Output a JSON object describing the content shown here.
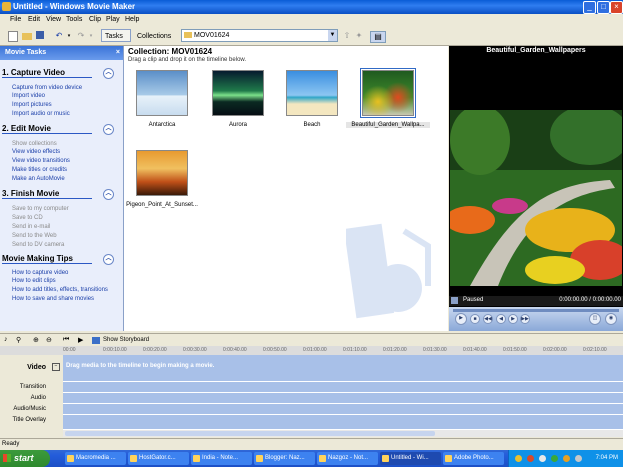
{
  "window": {
    "title": "Untitled - Windows Movie Maker"
  },
  "menu": [
    "File",
    "Edit",
    "View",
    "Tools",
    "Clip",
    "Play",
    "Help"
  ],
  "toolbar": {
    "tasks_label": "Tasks",
    "collections_label": "Collections",
    "combo_value": "MOV01624"
  },
  "taskpane": {
    "header": "Movie Tasks",
    "sections": [
      {
        "title": "1. Capture Video",
        "links": [
          {
            "label": "Capture from video device",
            "enabled": true
          },
          {
            "label": "Import video",
            "enabled": true
          },
          {
            "label": "Import pictures",
            "enabled": true
          },
          {
            "label": "Import audio or music",
            "enabled": true
          }
        ]
      },
      {
        "title": "2. Edit Movie",
        "links": [
          {
            "label": "Show collections",
            "enabled": false
          },
          {
            "label": "View video effects",
            "enabled": true
          },
          {
            "label": "View video transitions",
            "enabled": true
          },
          {
            "label": "Make titles or credits",
            "enabled": true
          },
          {
            "label": "Make an AutoMovie",
            "enabled": true
          }
        ]
      },
      {
        "title": "3. Finish Movie",
        "links": [
          {
            "label": "Save to my computer",
            "enabled": false
          },
          {
            "label": "Save to CD",
            "enabled": false
          },
          {
            "label": "Send in e-mail",
            "enabled": false
          },
          {
            "label": "Send to the Web",
            "enabled": false
          },
          {
            "label": "Send to DV camera",
            "enabled": false
          }
        ]
      },
      {
        "title": "Movie Making Tips",
        "links": [
          {
            "label": "How to capture video",
            "enabled": true
          },
          {
            "label": "How to edit clips",
            "enabled": true
          },
          {
            "label": "How to add titles, effects, transitions",
            "enabled": true
          },
          {
            "label": "How to save and share movies",
            "enabled": true
          }
        ]
      }
    ]
  },
  "collection": {
    "title": "Collection: MOV01624",
    "subtitle": "Drag a clip and drop it on the timeline below.",
    "clips": [
      {
        "label": "Antarctica"
      },
      {
        "label": "Aurora"
      },
      {
        "label": "Beach"
      },
      {
        "label": "Beautiful_Garden_Wallpa..."
      },
      {
        "label": "Pigeon_Point_At_Sunset..."
      }
    ]
  },
  "preview": {
    "title": "Beautiful_Garden_Wallpapers",
    "status": "Paused",
    "time": "0:00:00.00 / 0:00:00.00"
  },
  "timeline": {
    "show_storyboard": "Show Storyboard",
    "hint": "Drag media to the timeline to begin making a movie.",
    "tracks": [
      "Video",
      "Transition",
      "Audio",
      "Audio/Music",
      "Title Overlay"
    ],
    "ruler": [
      "00:00",
      "0:00:10.00",
      "0:00:20.00",
      "0:00:30.00",
      "0:00:40.00",
      "0:00:50.00",
      "0:01:00.00",
      "0:01:10.00",
      "0:01:20.00",
      "0:01:30.00",
      "0:01:40.00",
      "0:01:50.00",
      "0:02:00.00",
      "0:02:10.00"
    ]
  },
  "status": "Ready",
  "taskbar": {
    "start": "start",
    "tasks": [
      {
        "label": "Macromedia ...",
        "active": false
      },
      {
        "label": "HostGator.c...",
        "active": false
      },
      {
        "label": "India - Note...",
        "active": false
      },
      {
        "label": "Blogger: Naz...",
        "active": false
      },
      {
        "label": "Nazgoz - Not...",
        "active": false
      },
      {
        "label": "Untitled - Wi...",
        "active": true
      },
      {
        "label": "Adobe Photo...",
        "active": false
      }
    ],
    "clock": "7:04 PM"
  }
}
